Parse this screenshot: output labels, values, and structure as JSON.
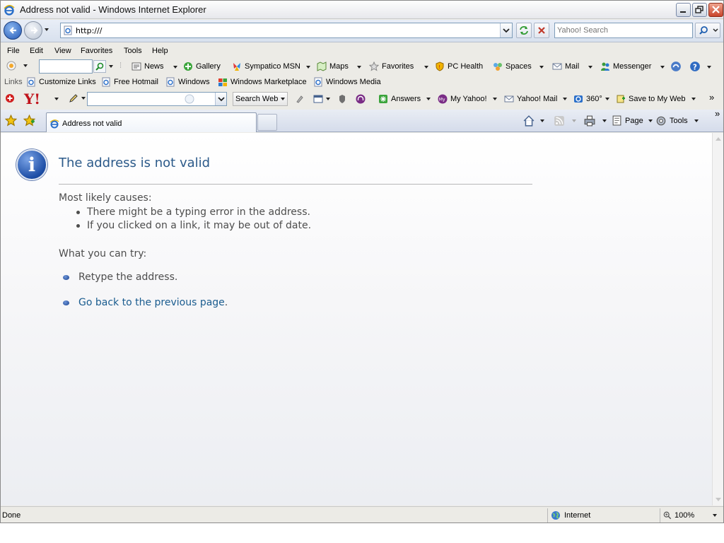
{
  "window": {
    "title": "Address not valid - Windows Internet Explorer"
  },
  "address_bar": {
    "url": "http:///",
    "search_placeholder": "Yahoo! Search"
  },
  "menu": [
    "File",
    "Edit",
    "View",
    "Favorites",
    "Tools",
    "Help"
  ],
  "msn_toolbar": {
    "items": [
      {
        "label": "News",
        "icon": "news-icon",
        "dropdown": true
      },
      {
        "label": "Gallery",
        "icon": "gallery-icon",
        "dropdown": false
      },
      {
        "label": "Sympatico MSN",
        "icon": "msn-butterfly-icon",
        "dropdown": true
      },
      {
        "label": "Maps",
        "icon": "maps-icon",
        "dropdown": true
      },
      {
        "label": "Favorites",
        "icon": "star-icon",
        "dropdown": true
      },
      {
        "label": "PC Health",
        "icon": "shield-icon",
        "dropdown": false
      },
      {
        "label": "Spaces",
        "icon": "spaces-icon",
        "dropdown": true
      },
      {
        "label": "Mail",
        "icon": "mail-icon",
        "dropdown": true
      },
      {
        "label": "Messenger",
        "icon": "messenger-icon",
        "dropdown": true
      }
    ]
  },
  "links_bar": {
    "label": "Links",
    "items": [
      "Customize Links",
      "Free Hotmail",
      "Windows",
      "Windows Marketplace",
      "Windows Media"
    ]
  },
  "yahoo_toolbar": {
    "logo": "Y!",
    "search_button": "Search Web",
    "items": [
      {
        "label": "Answers",
        "icon": "answers-icon",
        "dropdown": true
      },
      {
        "label": "My Yahoo!",
        "icon": "my-yahoo-icon",
        "dropdown": true
      },
      {
        "label": "Yahoo! Mail",
        "icon": "mail-icon",
        "dropdown": true
      },
      {
        "label": "360°",
        "icon": "yahoo-360-icon",
        "dropdown": true
      },
      {
        "label": "Save to My Web",
        "icon": "save-web-icon",
        "dropdown": true
      }
    ]
  },
  "tabs": {
    "active_label": "Address not valid",
    "page_label": "Page",
    "tools_label": "Tools"
  },
  "error_page": {
    "title": "The address is not valid",
    "causes_heading": "Most likely causes:",
    "causes": [
      "There might be a typing error in the address.",
      "If you clicked on a link, it may be out of date."
    ],
    "try_heading": "What you can try:",
    "retype": "Retype the address.",
    "go_back_link": "Go back to the previous page",
    "go_back_period": "."
  },
  "status_bar": {
    "status": "Done",
    "zone": "Internet",
    "zoom": "100%"
  },
  "colors": {
    "title_blue": "#2c5a8a",
    "link_blue": "#1a5c8f",
    "body_text": "#4d4d4d"
  }
}
